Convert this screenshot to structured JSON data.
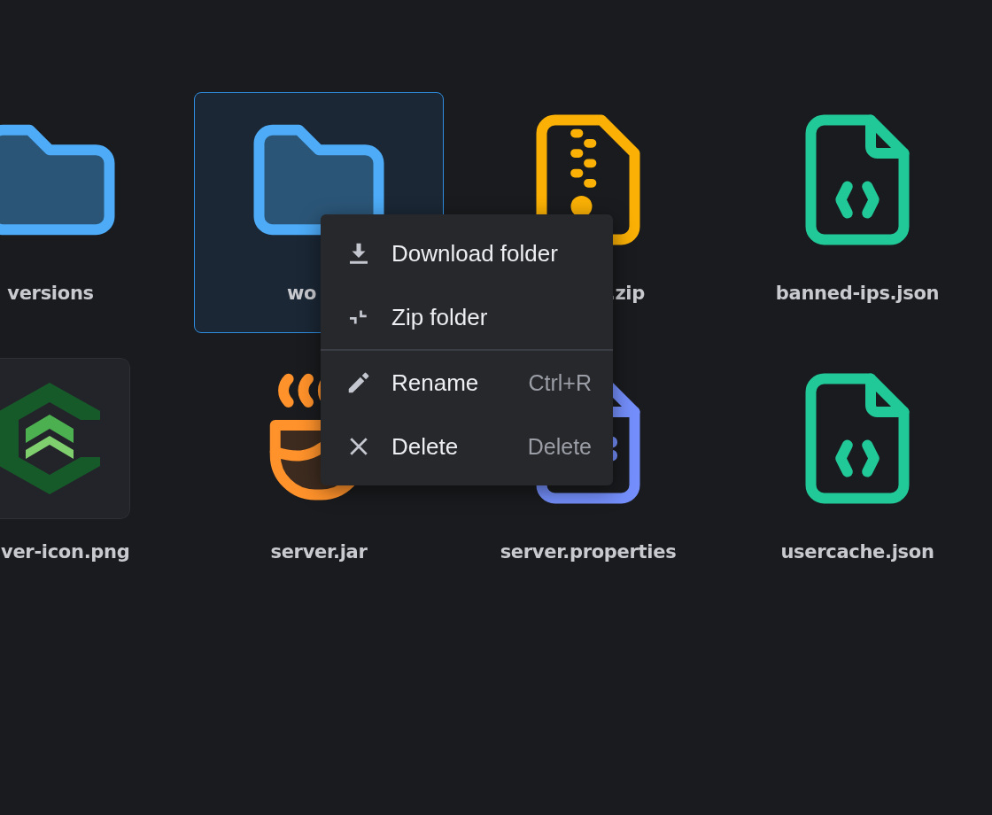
{
  "files": [
    {
      "name": "versions",
      "kind": "folder",
      "selected": false
    },
    {
      "name": "wo",
      "kind": "folder",
      "selected": true
    },
    {
      "name": ".zip",
      "kind": "archive",
      "selected": false
    },
    {
      "name": "banned-ips.json",
      "kind": "json",
      "selected": false
    },
    {
      "name": "ver-icon.png",
      "selected": false
    },
    {
      "name": "server.jar",
      "kind": "jar",
      "selected": false
    },
    {
      "name": "server.properties",
      "kind": "properties",
      "selected": false
    },
    {
      "name": "usercache.json",
      "kind": "json",
      "selected": false
    }
  ],
  "context_menu": {
    "groups": [
      [
        {
          "kind": "download",
          "label": "Download folder"
        },
        {
          "kind": "zip",
          "label": "Zip folder"
        }
      ],
      [
        {
          "kind": "rename",
          "label": "Rename",
          "shortcut": "Ctrl+R"
        },
        {
          "kind": "delete",
          "label": "Delete",
          "shortcut": "Delete"
        }
      ]
    ]
  }
}
